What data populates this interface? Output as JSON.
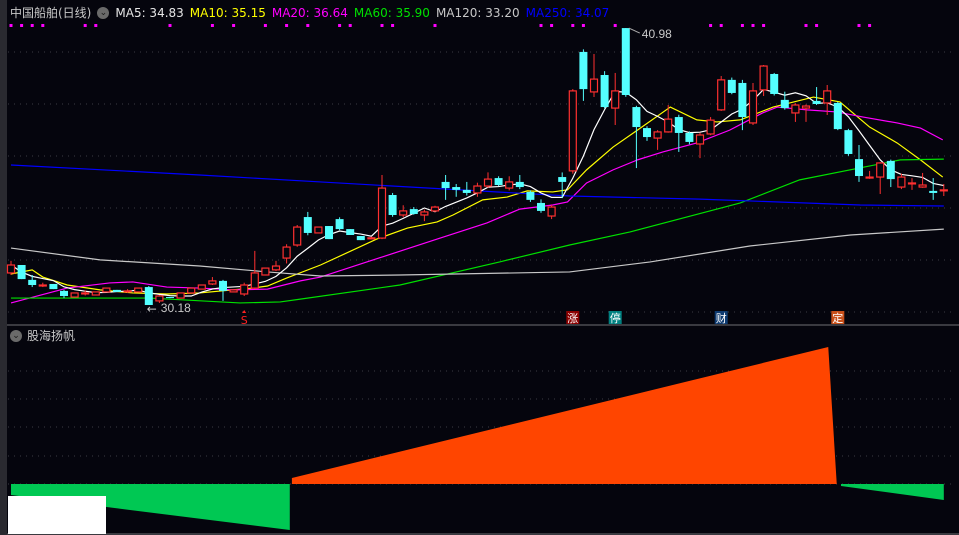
{
  "header": {
    "title": "中国船舶(日线)",
    "ma": [
      {
        "label": "MA5: 34.83",
        "color": "#e6e6e6"
      },
      {
        "label": "MA10: 35.15",
        "color": "#ffff00"
      },
      {
        "label": "MA20: 36.64",
        "color": "#ff00ff"
      },
      {
        "label": "MA60: 35.90",
        "color": "#00e000"
      },
      {
        "label": "MA120: 33.20",
        "color": "#c8c8c8"
      },
      {
        "label": "MA250: 34.07",
        "color": "#0000ff"
      }
    ]
  },
  "indicator": {
    "title": "股海扬帆",
    "colors": {
      "up": "#ff4500",
      "down": "#00c853"
    },
    "down_left": [
      [
        0,
        -1.1
      ],
      [
        26.3,
        -4.6
      ]
    ],
    "up": [
      [
        26.5,
        0.6
      ],
      [
        77.1,
        13.7
      ],
      [
        77.9,
        0
      ]
    ],
    "down_right": [
      [
        78.3,
        -0.2
      ],
      [
        88,
        -1.6
      ]
    ]
  },
  "chart_data": {
    "type": "candlestick",
    "title": "中国船舶(日线)",
    "colors": {
      "up": "#ff3030",
      "down": "#54ffff"
    },
    "high_label": "40.98",
    "low_label": "30.18",
    "high_index": 58,
    "low_index": 13,
    "candles": [
      [
        31.43,
        31.74,
        31.9,
        31.35
      ],
      [
        31.74,
        31.19
      ],
      [
        31.16,
        30.96,
        31.35,
        30.88
      ],
      [
        30.96,
        30.96,
        31.05,
        30.88
      ],
      [
        31.0,
        30.8
      ],
      [
        30.73,
        30.53,
        30.77,
        30.45
      ],
      [
        30.49,
        30.65
      ],
      [
        30.65,
        30.65,
        30.75,
        30.55
      ],
      [
        30.57,
        30.69
      ],
      [
        30.69,
        30.84
      ],
      [
        30.77,
        30.69
      ],
      [
        30.73,
        30.73,
        30.8,
        30.65
      ],
      [
        30.69,
        30.84
      ],
      [
        30.88,
        30.18,
        30.92,
        30.18
      ],
      [
        30.34,
        30.53,
        30.57,
        30.26
      ],
      [
        30.49,
        30.45
      ],
      [
        30.45,
        30.65
      ],
      [
        30.65,
        30.84
      ],
      [
        30.8,
        30.96
      ],
      [
        31.0,
        31.12,
        31.27,
        30.96
      ],
      [
        31.12,
        30.73,
        31.16,
        30.34
      ],
      [
        30.69,
        30.77
      ],
      [
        30.61,
        30.96,
        31.05,
        30.53
      ],
      [
        30.84,
        31.43,
        32.29,
        30.8
      ],
      [
        31.35,
        31.62
      ],
      [
        31.55,
        31.7,
        31.9,
        31.5
      ],
      [
        32.01,
        32.44,
        32.55,
        31.8
      ],
      [
        32.52,
        33.22,
        33.3,
        32.45
      ],
      [
        33.61,
        32.99,
        33.81,
        32.9
      ],
      [
        32.99,
        33.22
      ],
      [
        33.26,
        32.75
      ],
      [
        33.53,
        33.14,
        33.6,
        33.1
      ],
      [
        33.14,
        32.91
      ],
      [
        32.87,
        32.71
      ],
      [
        32.8,
        32.8,
        32.85,
        32.75
      ],
      [
        32.79,
        34.74,
        35.25,
        32.75
      ],
      [
        34.47,
        33.69,
        34.55,
        33.62
      ],
      [
        33.69,
        33.85,
        34.07,
        33.6
      ],
      [
        33.92,
        33.73,
        34.0,
        33.7
      ],
      [
        33.69,
        33.81,
        33.9,
        33.45
      ],
      [
        33.85,
        34.0,
        34.05,
        33.8
      ],
      [
        34.98,
        34.74,
        35.25,
        34.28
      ],
      [
        34.78,
        34.67,
        34.9,
        34.4
      ],
      [
        34.67,
        34.55,
        34.98,
        34.45
      ],
      [
        34.55,
        34.82,
        34.95,
        34.4
      ],
      [
        34.82,
        35.09,
        35.35,
        34.75
      ],
      [
        35.13,
        34.86,
        35.2,
        34.82
      ],
      [
        34.74,
        34.98,
        35.2,
        34.65
      ],
      [
        34.98,
        34.78,
        35.25,
        34.7
      ],
      [
        34.59,
        34.28,
        34.65,
        34.2
      ],
      [
        34.16,
        33.85,
        34.3,
        33.78
      ],
      [
        33.65,
        34.0,
        34.08,
        33.53
      ],
      [
        35.17,
        34.98,
        35.35,
        34.35
      ],
      [
        35.41,
        38.53,
        38.6,
        35.3
      ],
      [
        40.05,
        38.6,
        40.15,
        38.14
      ],
      [
        38.49,
        38.99,
        39.97,
        38.29
      ],
      [
        39.15,
        37.9,
        39.3,
        37.85
      ],
      [
        37.86,
        38.53,
        39.23,
        37.2
      ],
      [
        40.98,
        38.37,
        40.98,
        38.3
      ],
      [
        37.9,
        37.12,
        37.95,
        35.52
      ],
      [
        37.08,
        36.73,
        37.15,
        36.58
      ],
      [
        36.69,
        36.93,
        37.0,
        36.23
      ],
      [
        36.93,
        37.43,
        37.98,
        36.9
      ],
      [
        37.51,
        36.89,
        37.6,
        36.15
      ],
      [
        36.89,
        36.54,
        36.95,
        36.45
      ],
      [
        36.46,
        36.81,
        36.9,
        35.91
      ],
      [
        36.85,
        37.39,
        37.51,
        36.8
      ],
      [
        37.79,
        38.96,
        39.11,
        37.75
      ],
      [
        38.96,
        38.45,
        39.05,
        38.4
      ],
      [
        38.84,
        37.51,
        38.96,
        37.0
      ],
      [
        37.28,
        38.53,
        38.84,
        37.2
      ],
      [
        38.57,
        39.5,
        39.54,
        38.33
      ],
      [
        39.19,
        38.41,
        39.23,
        38.35
      ],
      [
        38.18,
        37.86,
        38.5,
        37.8
      ],
      [
        37.67,
        37.98,
        38.05,
        37.32
      ],
      [
        37.86,
        37.94,
        38.0,
        37.32
      ],
      [
        38.14,
        38.02,
        38.68,
        37.98
      ],
      [
        38.06,
        38.53,
        38.76,
        37.59
      ],
      [
        38.06,
        37.04,
        38.1,
        37.0
      ],
      [
        37.0,
        36.07,
        37.05,
        36.0
      ],
      [
        35.87,
        35.21,
        36.42,
        34.98
      ],
      [
        35.13,
        35.17,
        35.41,
        35.1
      ],
      [
        35.17,
        35.72,
        35.75,
        34.51
      ],
      [
        35.8,
        35.09,
        35.85,
        34.78
      ],
      [
        34.78,
        35.17,
        35.3,
        34.7
      ],
      [
        34.94,
        34.94,
        35.13,
        34.67
      ],
      [
        34.78,
        34.86,
        35.33,
        34.75
      ],
      [
        34.63,
        34.55,
        35.13,
        34.28
      ],
      [
        34.67,
        34.67,
        34.9,
        34.43
      ]
    ],
    "ma_lines": [
      {
        "name": "MA10",
        "color": "#ffff00",
        "points": [
          [
            0,
            31.39
          ],
          [
            2,
            31.55
          ],
          [
            3,
            31.27
          ],
          [
            5.3,
            30.96
          ],
          [
            8.4,
            30.77
          ],
          [
            11.5,
            30.65
          ],
          [
            14.7,
            30.61
          ],
          [
            17.8,
            30.65
          ],
          [
            20.9,
            30.77
          ],
          [
            22.8,
            30.84
          ],
          [
            24.2,
            30.92
          ],
          [
            26,
            31.23
          ],
          [
            29.2,
            31.74
          ],
          [
            34.5,
            32.75
          ],
          [
            37.4,
            33.18
          ],
          [
            40.2,
            33.42
          ],
          [
            41.7,
            33.69
          ],
          [
            44.5,
            34.28
          ],
          [
            46.8,
            34.39
          ],
          [
            48.7,
            34.63
          ],
          [
            51.1,
            34.59
          ],
          [
            52.5,
            34.67
          ],
          [
            54.3,
            35.45
          ],
          [
            56.8,
            36.34
          ],
          [
            59.1,
            37.0
          ],
          [
            62.2,
            37.9
          ],
          [
            64.7,
            37.4
          ],
          [
            66.6,
            37.32
          ],
          [
            68.8,
            37.4
          ],
          [
            71.9,
            37.9
          ],
          [
            75.7,
            38.29
          ],
          [
            78.2,
            38.1
          ],
          [
            81,
            37.12
          ],
          [
            83.6,
            36.5
          ],
          [
            85.8,
            35.84
          ],
          [
            87.9,
            35.17
          ]
        ]
      },
      {
        "name": "MA20",
        "color": "#ff00ff",
        "points": [
          [
            0,
            30.26
          ],
          [
            5.3,
            30.84
          ],
          [
            9.3,
            31.04
          ],
          [
            11.5,
            31.08
          ],
          [
            14.7,
            30.88
          ],
          [
            17.8,
            30.84
          ],
          [
            20.9,
            30.77
          ],
          [
            24.2,
            30.8
          ],
          [
            27.3,
            31.12
          ],
          [
            29.2,
            31.27
          ],
          [
            40.2,
            32.75
          ],
          [
            44.9,
            33.38
          ],
          [
            48,
            33.92
          ],
          [
            51.1,
            34.08
          ],
          [
            52.5,
            34.2
          ],
          [
            54.3,
            34.94
          ],
          [
            56.8,
            35.45
          ],
          [
            59.1,
            35.84
          ],
          [
            61.5,
            36.15
          ],
          [
            64.7,
            36.5
          ],
          [
            67.8,
            37.0
          ],
          [
            70.9,
            37.67
          ],
          [
            72.3,
            37.9
          ],
          [
            75.1,
            37.79
          ],
          [
            77.9,
            37.71
          ],
          [
            80.4,
            37.51
          ],
          [
            83.6,
            37.28
          ],
          [
            85.8,
            37.08
          ],
          [
            87.9,
            36.62
          ]
        ]
      },
      {
        "name": "MA60",
        "color": "#00e000",
        "points": [
          [
            0,
            30.45
          ],
          [
            13,
            30.45
          ],
          [
            21.6,
            30.26
          ],
          [
            25.4,
            30.3
          ],
          [
            27.3,
            30.41
          ],
          [
            36.7,
            30.96
          ],
          [
            46.1,
            31.86
          ],
          [
            52.7,
            32.52
          ],
          [
            58.4,
            33.03
          ],
          [
            68.8,
            34.16
          ],
          [
            74.4,
            35.06
          ],
          [
            83.9,
            35.84
          ],
          [
            88,
            35.87
          ]
        ]
      },
      {
        "name": "MA120",
        "color": "#c8c8c8",
        "points": [
          [
            0,
            32.4
          ],
          [
            8.4,
            31.94
          ],
          [
            17.8,
            31.7
          ],
          [
            24.2,
            31.47
          ],
          [
            29.2,
            31.31
          ],
          [
            36.7,
            31.35
          ],
          [
            52.7,
            31.47
          ],
          [
            60.3,
            31.86
          ],
          [
            69.7,
            32.48
          ],
          [
            79.2,
            32.91
          ],
          [
            88,
            33.14
          ]
        ]
      },
      {
        "name": "MA250",
        "color": "#0000ff",
        "points": [
          [
            0,
            35.64
          ],
          [
            17.8,
            35.25
          ],
          [
            29.2,
            34.98
          ],
          [
            42.4,
            34.67
          ],
          [
            52.7,
            34.43
          ],
          [
            65,
            34.31
          ],
          [
            80.1,
            34.08
          ],
          [
            88,
            34.04
          ]
        ]
      }
    ],
    "ma5_color": "#ffffff",
    "top_markers": [
      0,
      1,
      2,
      3,
      7,
      8,
      15,
      19,
      21,
      24,
      26,
      28,
      31,
      32,
      35,
      36,
      40,
      50,
      51,
      53,
      54,
      57,
      66,
      67,
      69,
      70,
      71,
      75,
      76,
      80,
      81
    ],
    "top_marker_color": "#ff00ff",
    "signals": [
      {
        "index": 22,
        "text": "S",
        "bg": "",
        "fg": "#ff2020"
      },
      {
        "index": 53,
        "text": "涨",
        "bg": "#8b0000",
        "fg": "#ffffff"
      },
      {
        "index": 57,
        "text": "停",
        "bg": "#008080",
        "fg": "#ffffff"
      },
      {
        "index": 67,
        "text": "财",
        "bg": "#0d3a70",
        "fg": "#ffffff"
      },
      {
        "index": 78,
        "text": "定",
        "bg": "#c8501a",
        "fg": "#ffffff"
      }
    ]
  }
}
